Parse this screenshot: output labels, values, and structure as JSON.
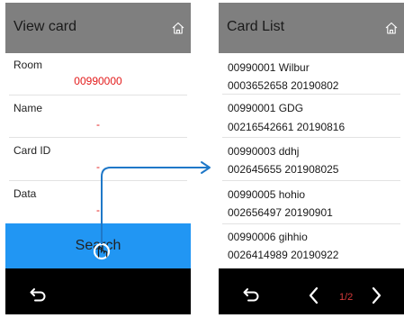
{
  "left_screen": {
    "title": "View card",
    "fields": [
      {
        "label": "Room",
        "value": "00990000"
      },
      {
        "label": "Name",
        "value": "-"
      },
      {
        "label": "Card ID",
        "value": "-"
      },
      {
        "label": "Data",
        "value": "-"
      }
    ],
    "search_label": "Search"
  },
  "right_screen": {
    "title": "Card List",
    "cards": [
      {
        "line1": "00990001 Wilbur",
        "line2": "0003652658  20190802"
      },
      {
        "line1": "00990001 GDG",
        "line2": "00216542661  20190816"
      },
      {
        "line1": "00990003 ddhj",
        "line2": "002645655  201908025"
      },
      {
        "line1": "00990005 hohio",
        "line2": "002656497  20190901"
      },
      {
        "line1": "00990006 gihhio",
        "line2": "0026414989  20190922"
      }
    ],
    "page_indicator": "1/2"
  },
  "icons": {
    "home": "home-icon",
    "back": "undo-arrow-icon",
    "prev": "chevron-left-icon",
    "next": "chevron-right-icon",
    "tap": "tap-pointer-icon"
  },
  "colors": {
    "header_bg": "#7f7f7f",
    "search_button_bg": "#2196f3",
    "footer_bg": "#000000",
    "value_text": "#e31b1b",
    "connector_arrow": "#1f78c8"
  }
}
